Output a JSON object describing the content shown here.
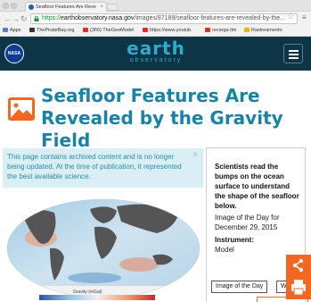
{
  "browser": {
    "tab_title": "Seafloor Features Are Reve",
    "tab_close": "×",
    "url_scheme": "https://",
    "url_host": "earthobservatory.nasa.gov",
    "url_path": "/images/87189/seafloor-features-are-revealed-by-the...",
    "bookmarks": [
      "Apps",
      "ThePirateBay.org",
      "(366) TheGeoModel",
      "https://www.youtub",
      "recarga tim",
      "Rastreamento"
    ]
  },
  "header": {
    "nasa_logo_text": "NASA",
    "earth_word": "earth",
    "observatory_word": "observatory"
  },
  "article": {
    "title": "Seafloor Features Are Revealed by the Gravity Field"
  },
  "notice": {
    "text": "This page contains archived content and is no longer being updated. At the time of publication, it represented the best available science.",
    "close": "×"
  },
  "figure": {
    "legend_label": "Gravity (mGal)"
  },
  "panel": {
    "lead": "Scientists read the bumps on the ocean surface to understand the shape of the seafloor below.",
    "date": "Image of the Day for December 29, 2015",
    "instrument_label": "Instrument:",
    "instrument_value": "Model",
    "tag_1": "Image of the Day",
    "tag_2": "Wate"
  },
  "colors": {
    "header_bg": "#0d3547",
    "brand_cyan": "#32a9ca",
    "title_blue": "#1a82a4",
    "accent_orange": "#f26722",
    "notice_bg": "#d9eef5"
  }
}
